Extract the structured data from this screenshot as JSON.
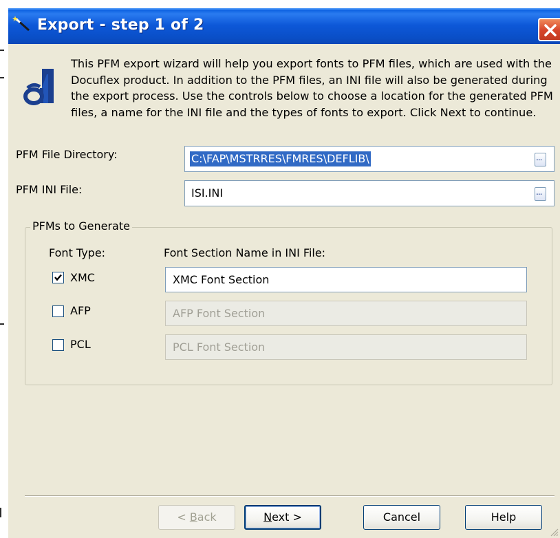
{
  "window": {
    "title": "Export - step 1 of 2"
  },
  "intro_text": "This PFM export wizard will help you export fonts to PFM files, which are used with the Docuflex product.  In addition to the PFM files, an INI file will also be generated during the export process.  Use the controls below to choose a location for the generated PFM files, a name for the INI file and the types of fonts to export.  Click Next to continue.",
  "pfm_directory": {
    "label": "PFM File Directory:",
    "value": "C:\\FAP\\MSTRRES\\FMRES\\DEFLIB\\",
    "browse_label": "..."
  },
  "pfm_ini": {
    "label": "PFM INI File:",
    "value": "ISI.INI",
    "browse_label": "..."
  },
  "group": {
    "legend": "PFMs to Generate",
    "col_font_type": "Font Type:",
    "col_section_name": "Font Section Name in INI File:",
    "rows": [
      {
        "label": "XMC",
        "checked": true,
        "section": "XMC Font Section",
        "enabled": true
      },
      {
        "label": "AFP",
        "checked": false,
        "section": "AFP Font Section",
        "enabled": false
      },
      {
        "label": "PCL",
        "checked": false,
        "section": "PCL Font Section",
        "enabled": false
      }
    ]
  },
  "buttons": {
    "back": {
      "prefix": "< ",
      "mnemonic": "B",
      "rest": "ack"
    },
    "next": {
      "mnemonic": "N",
      "rest": "ext >"
    },
    "cancel": "Cancel",
    "help": "Help"
  },
  "colors": {
    "titlebar": "#0a4fc8",
    "dialog_bg": "#ece9d8",
    "selection": "#316ac5",
    "close_button": "#d6442a"
  },
  "icons": [
    "wand-icon",
    "close-icon",
    "font-wizard-logo-icon",
    "ellipsis-icon",
    "checkmark-icon",
    "resize-grip-icon"
  ]
}
